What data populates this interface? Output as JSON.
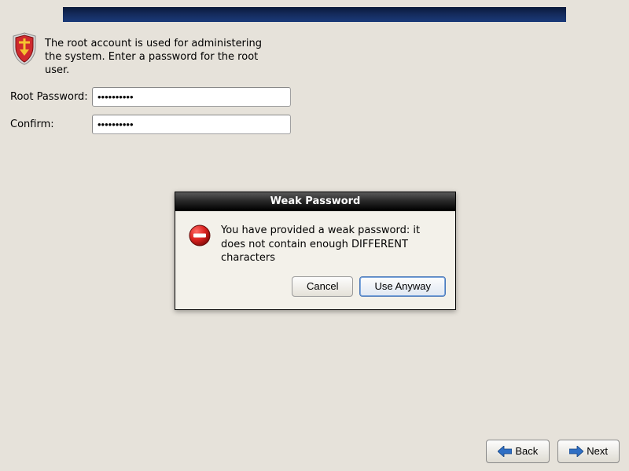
{
  "banner": {},
  "intro": {
    "text": "The root account is used for administering the system.  Enter a password for the root user."
  },
  "form": {
    "password_label": "Root Password:",
    "password_value": "••••••••••",
    "confirm_label": "Confirm:",
    "confirm_value": "••••••••••"
  },
  "dialog": {
    "title": "Weak Password",
    "message": "You have provided a weak password: it does not contain enough DIFFERENT characters",
    "cancel_label": "Cancel",
    "use_anyway_label": "Use Anyway"
  },
  "nav": {
    "back_label": "Back",
    "next_label": "Next"
  }
}
